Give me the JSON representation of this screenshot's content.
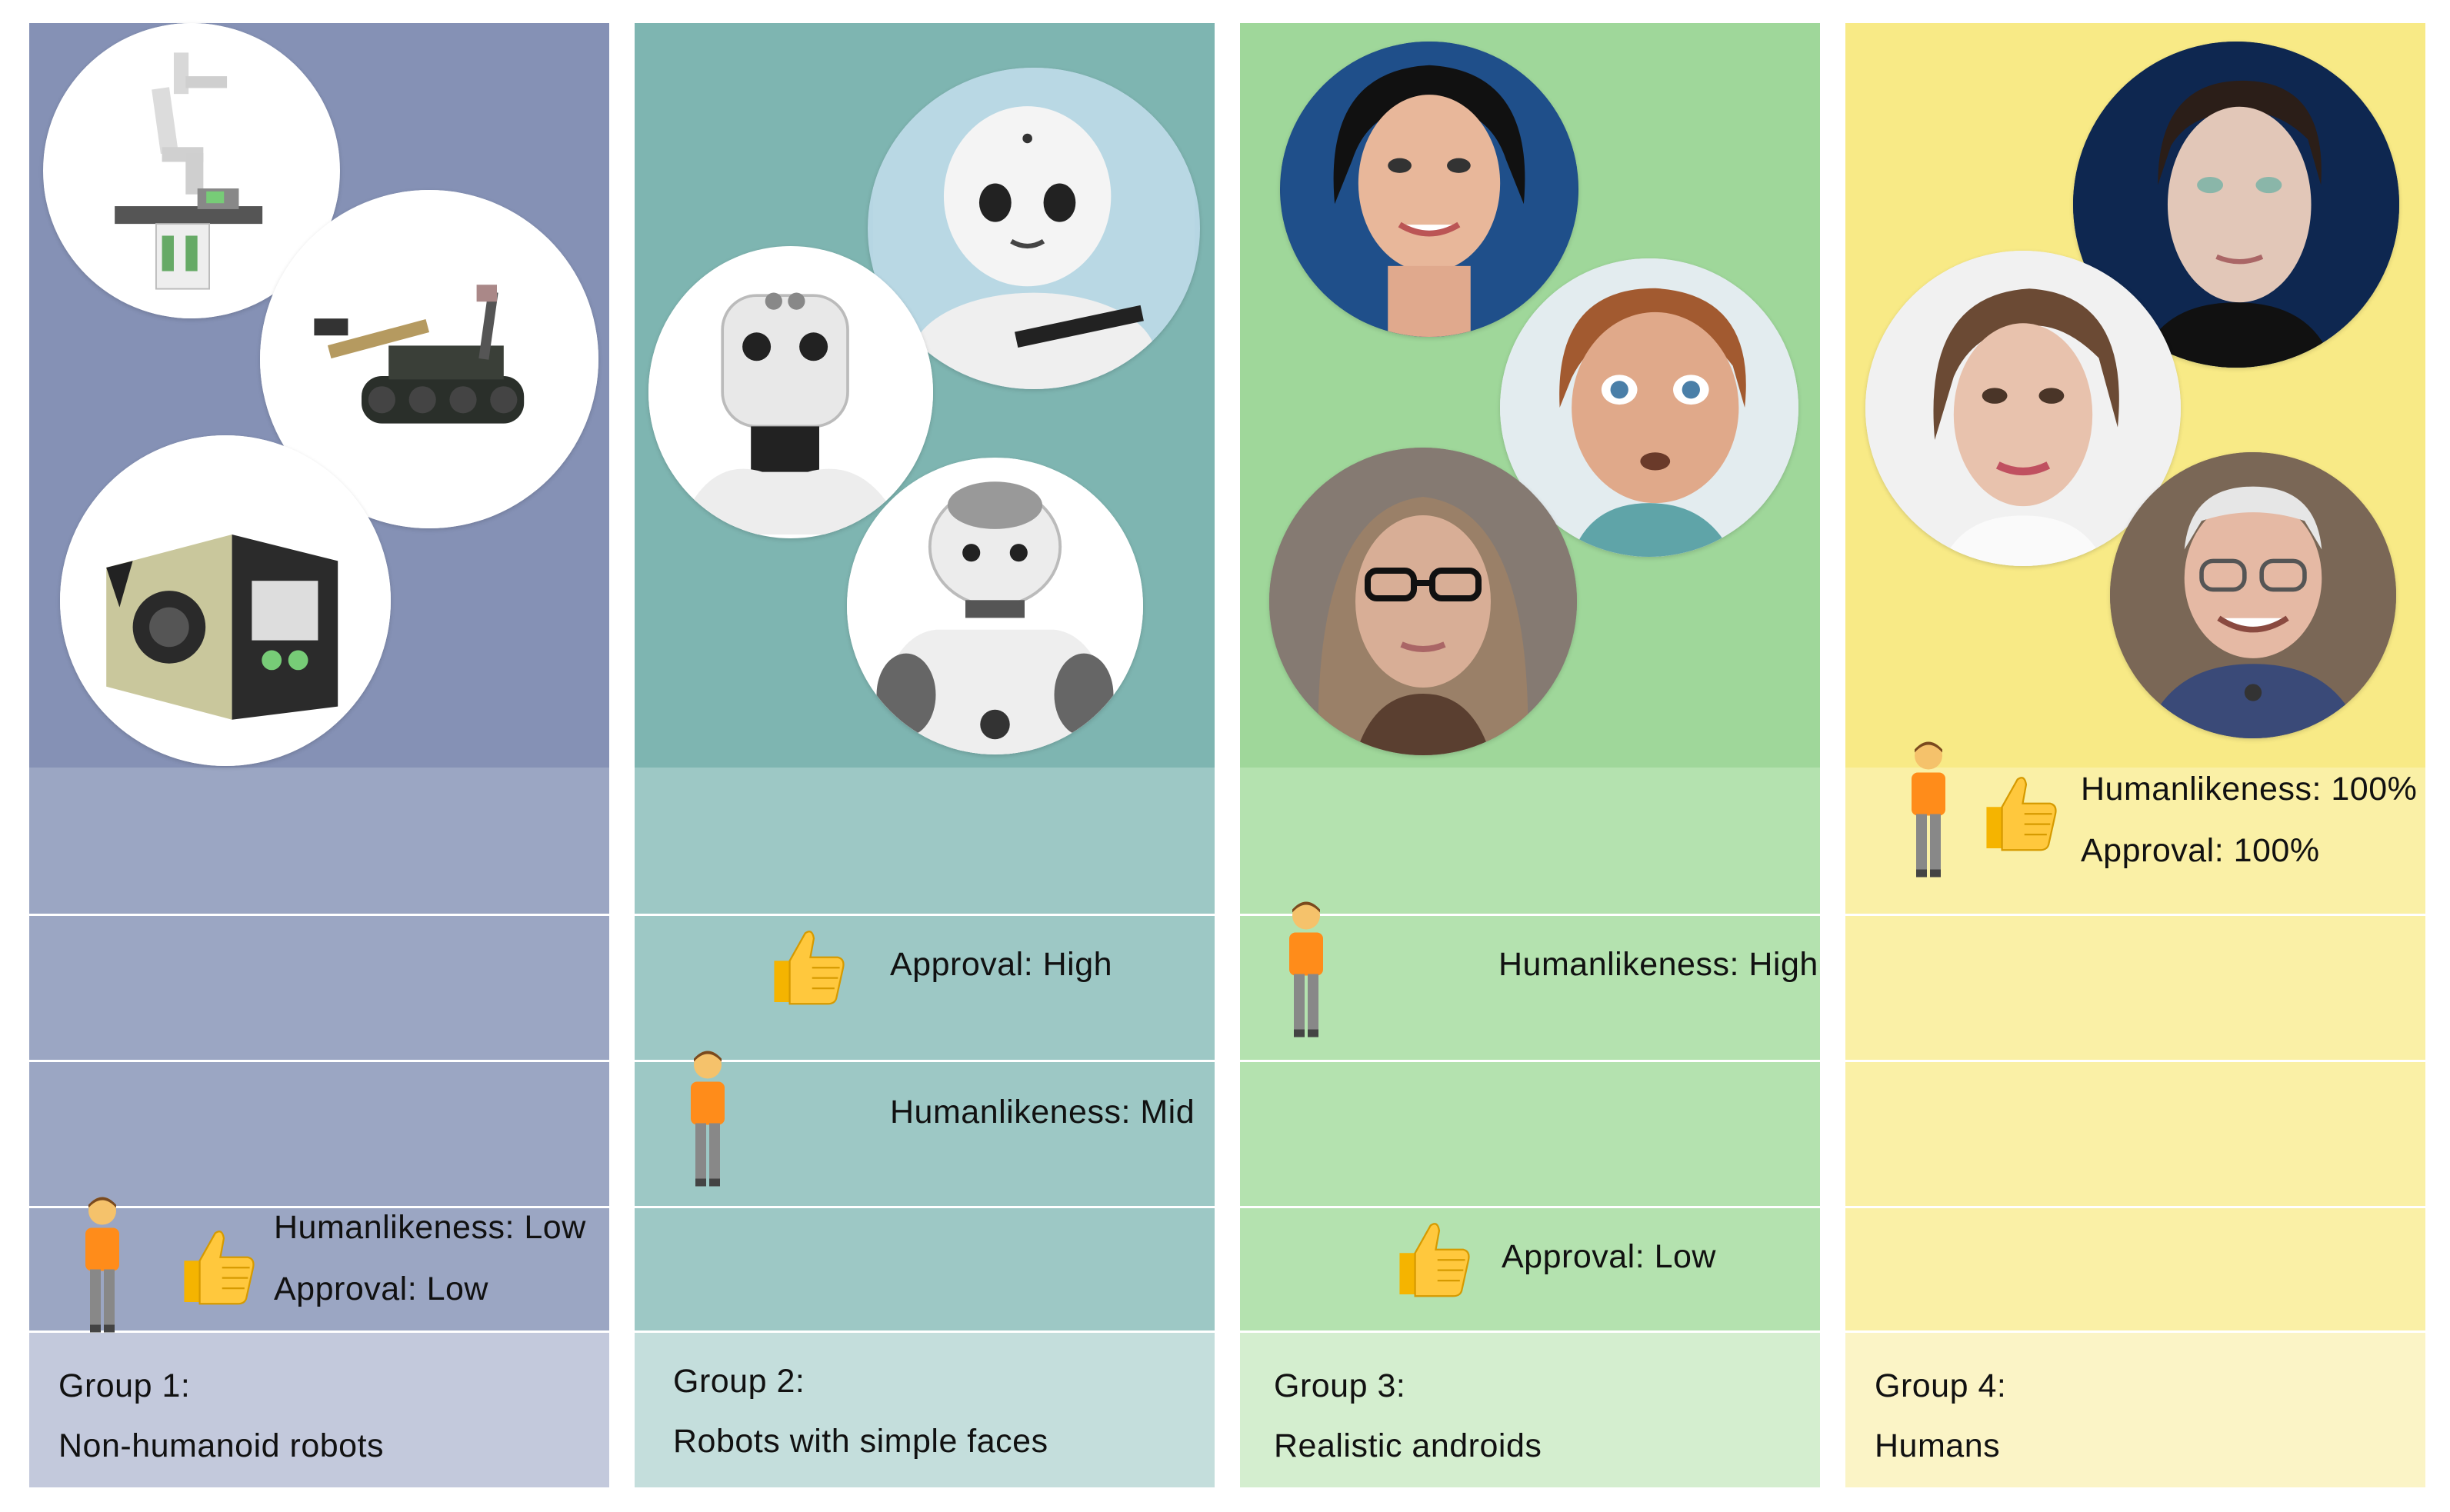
{
  "groups": [
    {
      "id": "group-1",
      "title": "Group 1:",
      "subtitle": "Non-humanoid robots",
      "humanlikeness": "Humanlikeness: Low",
      "approval": "Approval: Low",
      "colors": {
        "image": "#8591b5",
        "band": "#9ba6c3",
        "label": "#c3c9dc"
      }
    },
    {
      "id": "group-2",
      "title": "Group 2:",
      "subtitle": "Robots with simple faces",
      "humanlikeness": "Humanlikeness: Mid",
      "approval": "Approval: High",
      "colors": {
        "image": "#7eb5b1",
        "band": "#9dc8c5",
        "label": "#c4dedc"
      }
    },
    {
      "id": "group-3",
      "title": "Group 3:",
      "subtitle": "Realistic androids",
      "humanlikeness": "Humanlikeness: High",
      "approval": "Approval: Low",
      "colors": {
        "image": "#9fd79a",
        "band": "#b4e2af",
        "label": "#d4eecf"
      }
    },
    {
      "id": "group-4",
      "title": "Group 4:",
      "subtitle": "Humans",
      "humanlikeness": "Humanlikeness: 100%",
      "approval": "Approval: 100%",
      "colors": {
        "image": "#f8ea86",
        "band": "#faf0a6",
        "label": "#fbf4c6"
      }
    }
  ],
  "icons": {
    "person": "person-icon",
    "thumbs_up": "thumbs-up-icon"
  }
}
